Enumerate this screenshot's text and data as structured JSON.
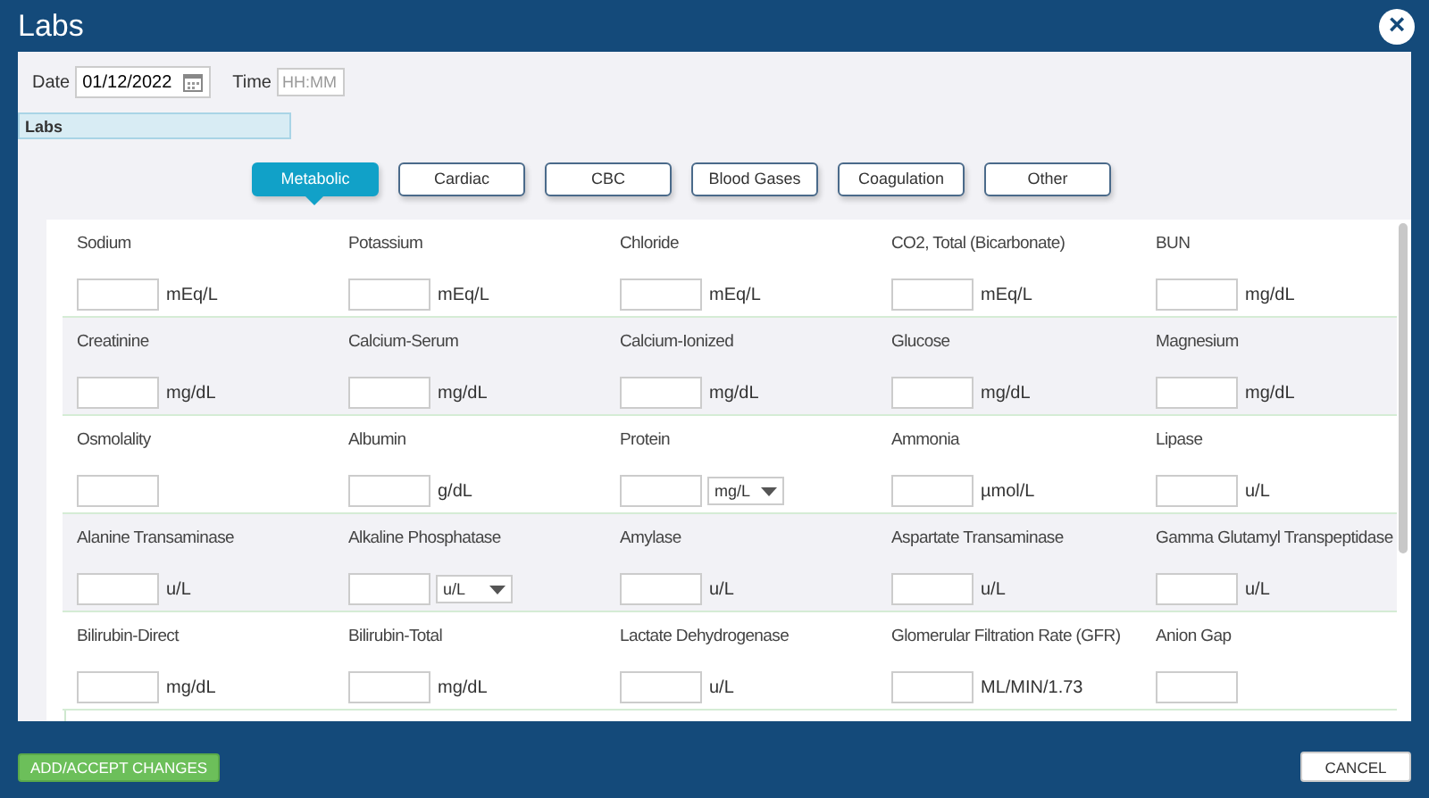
{
  "window": {
    "title": "Labs",
    "close": "×"
  },
  "date": {
    "label": "Date",
    "value": "01/12/2022"
  },
  "time": {
    "label": "Time",
    "placeholder": "HH:MM"
  },
  "section": "Labs",
  "tabs": [
    {
      "label": "Metabolic",
      "selected": true
    },
    {
      "label": "Cardiac",
      "selected": false
    },
    {
      "label": "CBC",
      "selected": false
    },
    {
      "label": "Blood Gases",
      "selected": false
    },
    {
      "label": "Coagulation",
      "selected": false
    },
    {
      "label": "Other",
      "selected": false
    }
  ],
  "rows": [
    [
      {
        "label": "Sodium",
        "kind": "unit",
        "unit": "mEq/L"
      },
      {
        "label": "Potassium",
        "kind": "unit",
        "unit": "mEq/L"
      },
      {
        "label": "Chloride",
        "kind": "unit",
        "unit": "mEq/L"
      },
      {
        "label": "CO2, Total (Bicarbonate)",
        "kind": "unit",
        "unit": "mEq/L"
      },
      {
        "label": "BUN",
        "kind": "unit",
        "unit": "mg/dL"
      }
    ],
    [
      {
        "label": "Creatinine",
        "kind": "unit",
        "unit": "mg/dL"
      },
      {
        "label": "Calcium-Serum",
        "kind": "unit",
        "unit": "mg/dL"
      },
      {
        "label": "Calcium-Ionized",
        "kind": "unit",
        "unit": "mg/dL"
      },
      {
        "label": "Glucose",
        "kind": "unit",
        "unit": "mg/dL"
      },
      {
        "label": "Magnesium",
        "kind": "unit",
        "unit": "mg/dL"
      }
    ],
    [
      {
        "label": "Osmolality",
        "kind": "plain"
      },
      {
        "label": "Albumin",
        "kind": "unit",
        "unit": "g/dL"
      },
      {
        "label": "Protein",
        "kind": "select",
        "unit": "mg/L"
      },
      {
        "label": "Ammonia",
        "kind": "unit",
        "unit": "µmol/L"
      },
      {
        "label": "Lipase",
        "kind": "unit",
        "unit": "u/L"
      }
    ],
    [
      {
        "label": "Alanine Transaminase",
        "kind": "unit",
        "unit": "u/L"
      },
      {
        "label": "Alkaline Phosphatase",
        "kind": "select",
        "unit": "u/L"
      },
      {
        "label": "Amylase",
        "kind": "unit",
        "unit": "u/L"
      },
      {
        "label": "Aspartate Transaminase",
        "kind": "unit",
        "unit": "u/L"
      },
      {
        "label": "Gamma Glutamyl Transpeptidase",
        "kind": "unit",
        "unit": "u/L"
      }
    ],
    [
      {
        "label": "Bilirubin-Direct",
        "kind": "unit",
        "unit": "mg/dL"
      },
      {
        "label": "Bilirubin-Total",
        "kind": "unit",
        "unit": "mg/dL"
      },
      {
        "label": "Lactate Dehydrogenase",
        "kind": "unit",
        "unit": "u/L"
      },
      {
        "label": "Glomerular Filtration Rate (GFR)",
        "kind": "unit",
        "unit": "ML/MIN/1.73"
      },
      {
        "label": "Anion Gap",
        "kind": "plain"
      }
    ]
  ],
  "buttons": {
    "accept": "ADD/ACCEPT CHANGES",
    "cancel": "CANCEL"
  }
}
